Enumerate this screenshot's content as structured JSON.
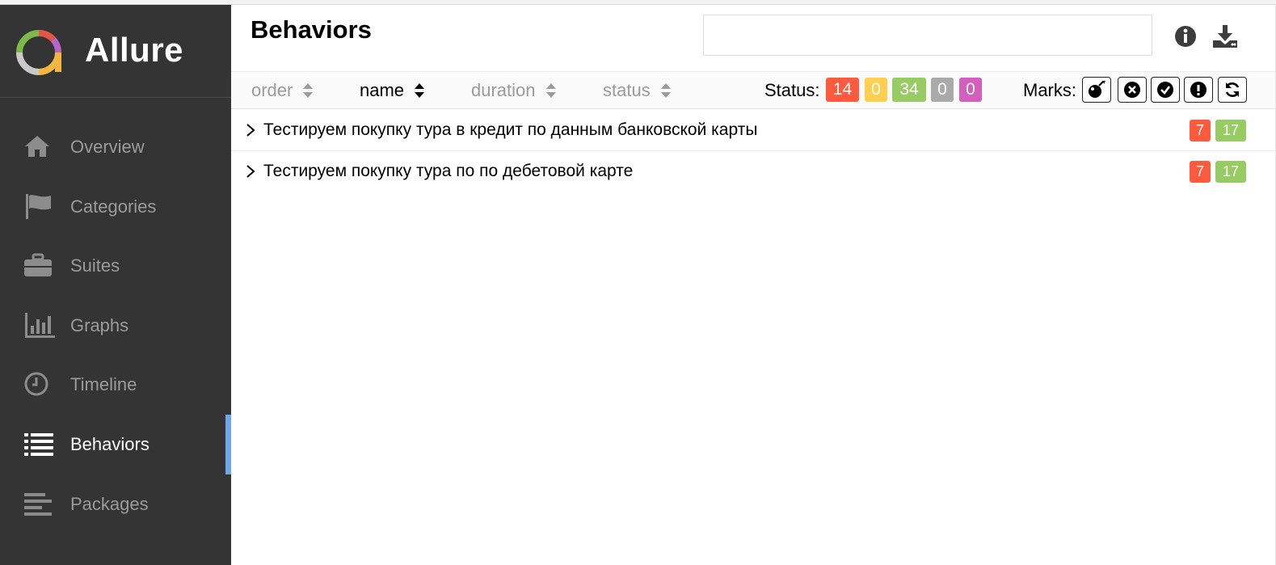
{
  "brand": {
    "name": "Allure"
  },
  "nav": {
    "items": [
      {
        "label": "Overview",
        "icon": "home-icon"
      },
      {
        "label": "Categories",
        "icon": "flag-icon"
      },
      {
        "label": "Suites",
        "icon": "briefcase-icon"
      },
      {
        "label": "Graphs",
        "icon": "bar-chart-icon"
      },
      {
        "label": "Timeline",
        "icon": "clock-icon"
      },
      {
        "label": "Behaviors",
        "icon": "list-icon",
        "active": true
      },
      {
        "label": "Packages",
        "icon": "align-left-icon"
      }
    ]
  },
  "header": {
    "title": "Behaviors",
    "search": {
      "value": "",
      "placeholder": ""
    },
    "info_icon": "info-icon",
    "download_icon": "download-icon"
  },
  "toolbar": {
    "sorters": [
      {
        "label": "order",
        "active": false
      },
      {
        "label": "name",
        "active": true
      },
      {
        "label": "duration",
        "active": false
      },
      {
        "label": "status",
        "active": false
      }
    ],
    "status_label": "Status:",
    "status_counts": [
      {
        "status": "failed",
        "value": "14",
        "color": "#fd5a3e"
      },
      {
        "status": "broken",
        "value": "0",
        "color": "#ffd050"
      },
      {
        "status": "passed",
        "value": "34",
        "color": "#97cc64"
      },
      {
        "status": "skipped",
        "value": "0",
        "color": "#aaaaaa"
      },
      {
        "status": "unknown",
        "value": "0",
        "color": "#d35ebe"
      }
    ],
    "marks_label": "Marks:",
    "marks": [
      "flaky-icon",
      "new-failed-icon",
      "new-passed-icon",
      "new-broken-icon",
      "retries-icon"
    ]
  },
  "tree": {
    "rows": [
      {
        "title": "Тестируем покупку тура в кредит по данным банковской карты",
        "failed": "7",
        "passed": "17"
      },
      {
        "title": "Тестируем покупку тура по по дебетовой карте",
        "failed": "7",
        "passed": "17"
      }
    ]
  },
  "colors": {
    "sidebar_bg": "#343434",
    "active_indicator": "#6ea7e8",
    "failed": "#fd5a3e",
    "passed": "#97cc64"
  }
}
